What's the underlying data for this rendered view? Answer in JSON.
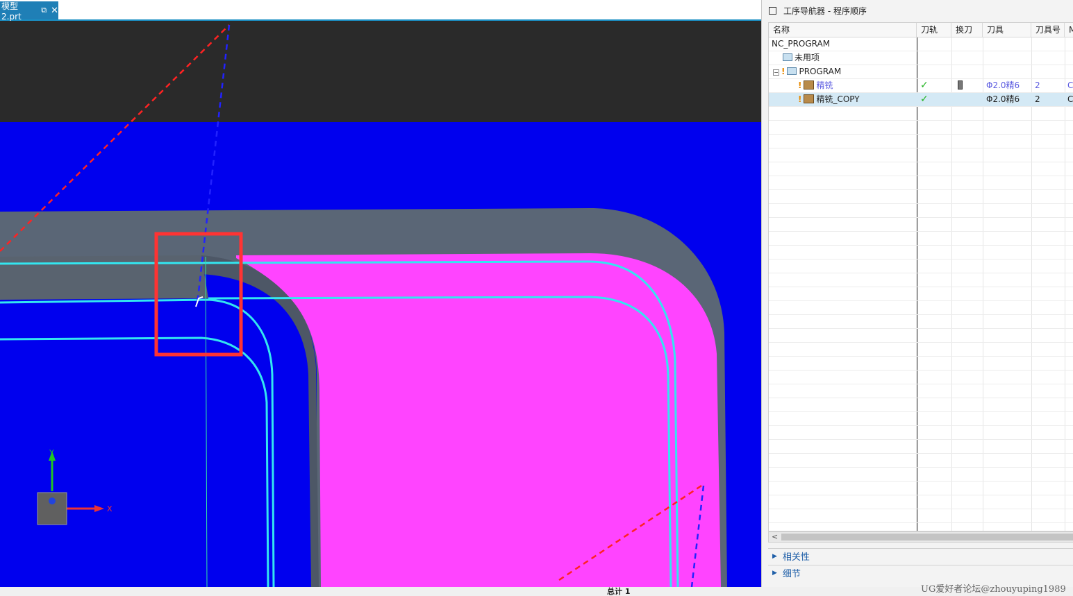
{
  "viewport": {
    "file_tab": "模型2.prt",
    "axis_x": "X",
    "axis_y": "Y"
  },
  "navigator": {
    "title": "工序导航器 - 程序顺序",
    "columns": [
      "名称",
      "刀轨",
      "换刀",
      "刀具",
      "刀具号",
      "M"
    ],
    "rows": [
      {
        "name": "NC_PROGRAM",
        "toolpath": "",
        "tool": "",
        "tool_no": "",
        "m": ""
      },
      {
        "name": "未用项",
        "toolpath": "",
        "tool": "",
        "tool_no": "",
        "m": ""
      },
      {
        "name": "PROGRAM",
        "toolpath": "",
        "tool": "",
        "tool_no": "",
        "m": ""
      },
      {
        "name": "精铣",
        "toolpath": "✓",
        "tool": "Φ2.0精6",
        "tool_no": "2",
        "m": "C"
      },
      {
        "name": "精铣_COPY",
        "toolpath": "✓",
        "tool": "Φ2.0精6",
        "tool_no": "2",
        "m": "C"
      }
    ],
    "sections": [
      "相关性",
      "细节"
    ]
  },
  "statusbar": {
    "total": "总计 1",
    "watermark": "UG爱好者论坛@zhouyuping1989"
  },
  "colors": {
    "background": "#0000ee",
    "part_surface": "#ff44ff",
    "wall": "#5a6676",
    "toolpath": "#33e6f0",
    "highlight_box": "#ff3333"
  }
}
